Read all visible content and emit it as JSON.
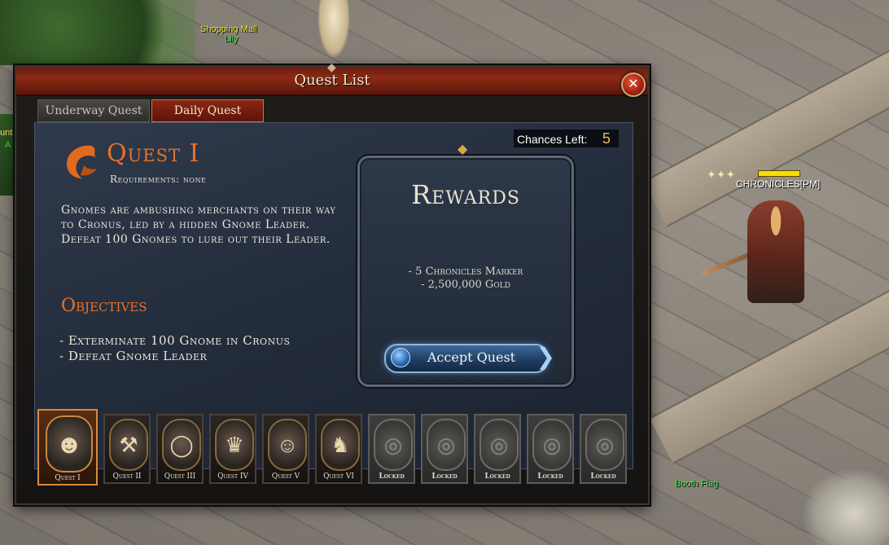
{
  "world": {
    "npc_shop_label": "Shopping Mall",
    "npc_name": "Lily",
    "player_name": "CHRONICLES[PM]",
    "booth_label": "Booth Flag",
    "edge_text_1": "unt",
    "edge_text_2": "A"
  },
  "window": {
    "title": "Quest List",
    "close_icon": "✕"
  },
  "tabs": [
    {
      "label": "Underway Quest",
      "active": false
    },
    {
      "label": "Daily Quest",
      "active": true
    }
  ],
  "chances": {
    "label": "Chances Left:",
    "value": "5"
  },
  "quest": {
    "logo_icon": "dragon-emblem-icon",
    "title": "Quest I",
    "requirements": "Requirements: none",
    "description": "Gnomes are ambushing merchants on their way to Cronus, led by a hidden Gnome Leader. Defeat 100 Gnomes to lure out their Leader.",
    "objectives_heading": "Objectives",
    "objectives": [
      "- Exterminate 100 Gnome in Cronus",
      "- Defeat Gnome Leader"
    ]
  },
  "rewards": {
    "title": "Rewards",
    "items": [
      "- 5 Chronicles Marker",
      "- 2,500,000 Gold"
    ],
    "accept_label": "Accept Quest"
  },
  "quest_slots": [
    {
      "label": "Quest I",
      "icon": "☻",
      "icon_name": "gnome-portrait-icon",
      "active": true,
      "locked": false
    },
    {
      "label": "Quest II",
      "icon": "⚒",
      "icon_name": "hammer-icon",
      "active": false,
      "locked": false
    },
    {
      "label": "Quest III",
      "icon": "◯",
      "icon_name": "egg-icon",
      "active": false,
      "locked": false
    },
    {
      "label": "Quest IV",
      "icon": "♛",
      "icon_name": "crown-icon",
      "active": false,
      "locked": false
    },
    {
      "label": "Quest V",
      "icon": "☺",
      "icon_name": "blue-maiden-icon",
      "active": false,
      "locked": false
    },
    {
      "label": "Quest VI",
      "icon": "♞",
      "icon_name": "wolf-icon",
      "active": false,
      "locked": false
    },
    {
      "label": "Locked",
      "icon": "◎",
      "icon_name": "locked-emblem-icon",
      "active": false,
      "locked": true
    },
    {
      "label": "Locked",
      "icon": "◎",
      "icon_name": "locked-emblem-icon",
      "active": false,
      "locked": true
    },
    {
      "label": "Locked",
      "icon": "◎",
      "icon_name": "locked-emblem-icon",
      "active": false,
      "locked": true
    },
    {
      "label": "Locked",
      "icon": "◎",
      "icon_name": "locked-emblem-icon",
      "active": false,
      "locked": true
    },
    {
      "label": "Locked",
      "icon": "◎",
      "icon_name": "locked-emblem-icon",
      "active": false,
      "locked": true
    }
  ],
  "colors": {
    "accent_orange": "#e8722a",
    "title_red": "#8c2a14",
    "accept_blue": "#1f3e63"
  }
}
